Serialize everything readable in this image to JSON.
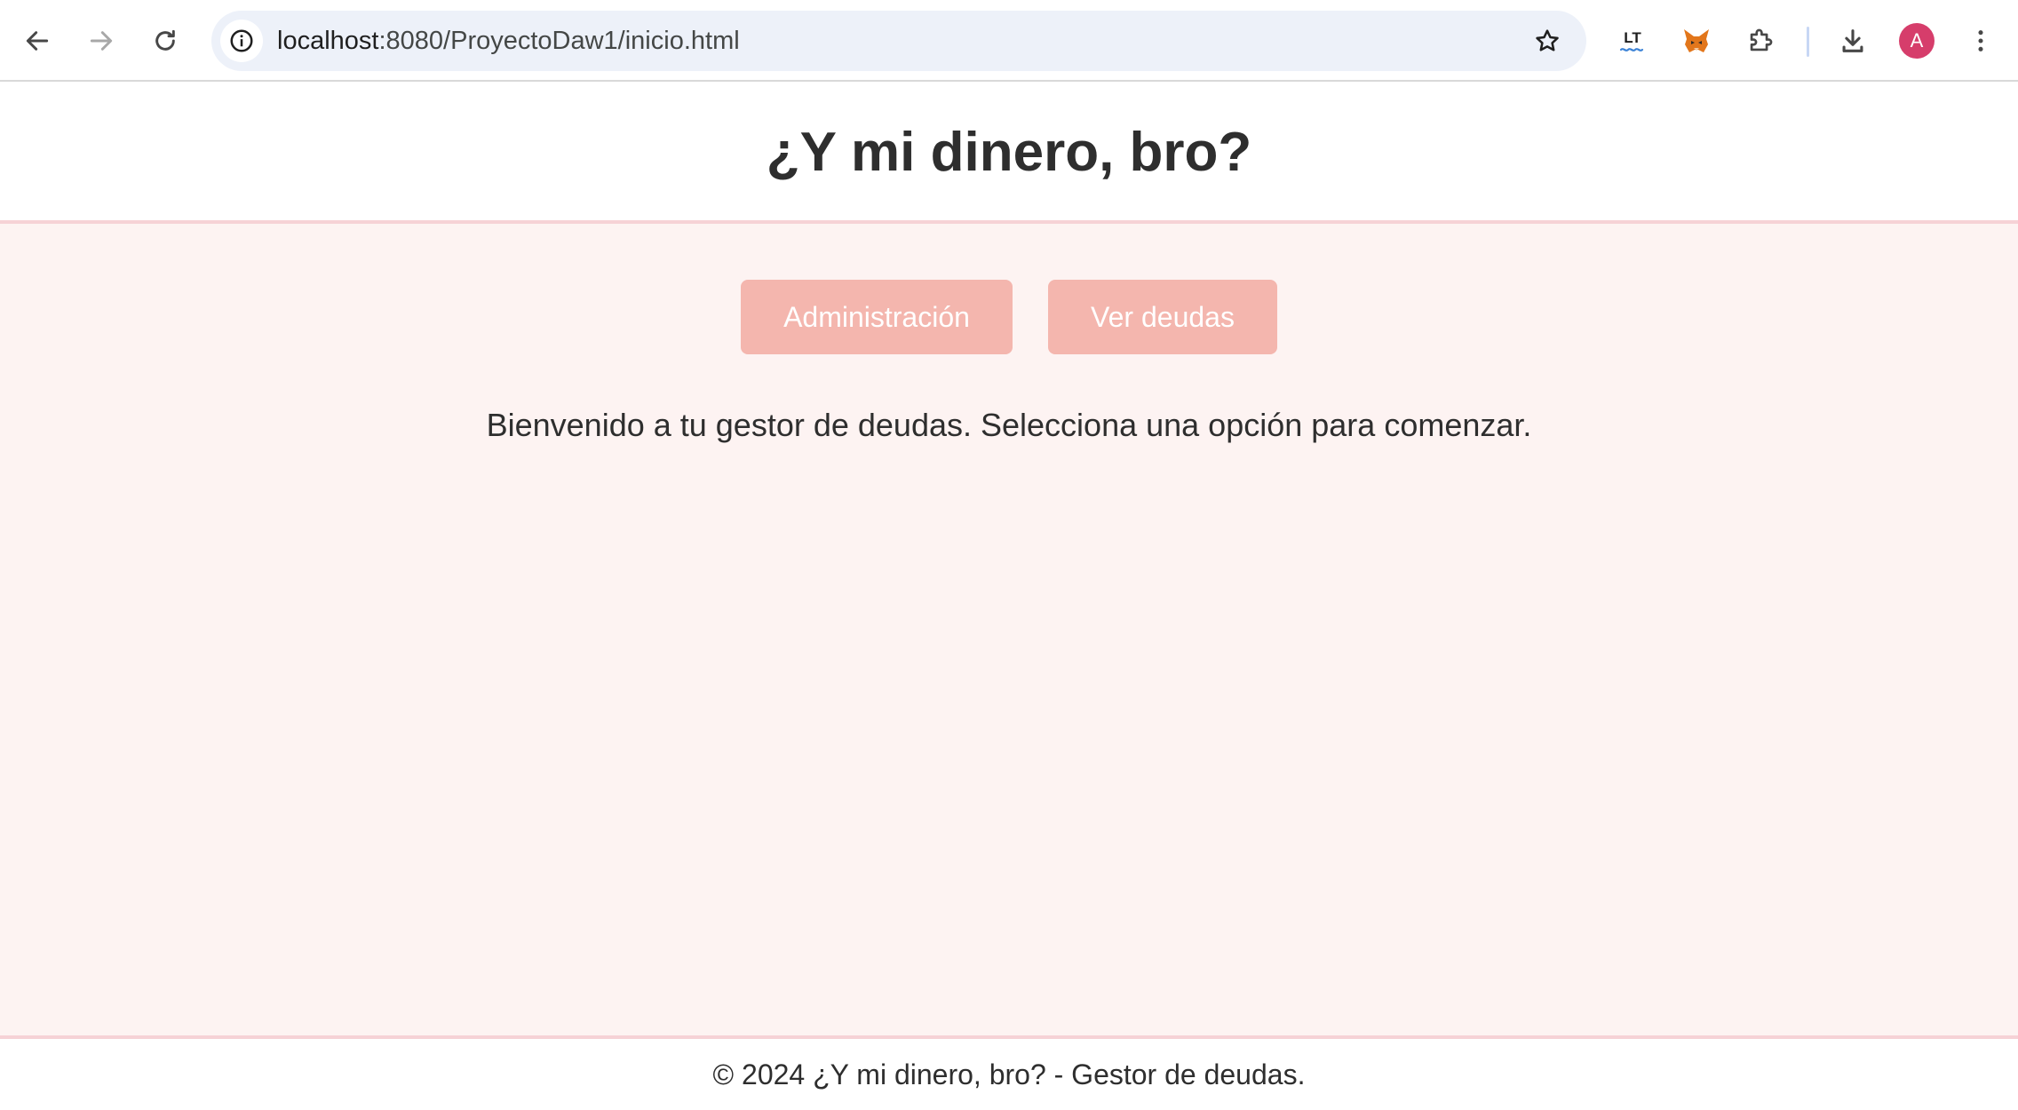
{
  "browser": {
    "url_host": "localhost",
    "url_path": ":8080/ProyectoDaw1/inicio.html",
    "profile_initial": "A",
    "icons": {
      "back": "arrow-left-icon",
      "forward": "arrow-right-icon",
      "reload": "reload-icon",
      "site_info": "info-icon",
      "bookmark": "star-icon",
      "ext_languagetool": "languagetool-icon",
      "ext_metamask": "fox-icon",
      "extensions": "puzzle-icon",
      "downloads": "download-icon",
      "menu": "kebab-menu-icon"
    },
    "ext_languagetool_label": "LT"
  },
  "page": {
    "title": "¿Y mi dinero, bro?",
    "buttons": {
      "admin": "Administración",
      "debts": "Ver deudas"
    },
    "welcome": "Bienvenido a tu gestor de deudas. Selecciona una opción para comenzar.",
    "footer": "© 2024 ¿Y mi dinero, bro? - Gestor de deudas."
  },
  "colors": {
    "accent_button": "#f4b6ae",
    "main_background": "#fdf3f2",
    "divider": "#f6d2d6",
    "avatar": "#d63d6b"
  }
}
